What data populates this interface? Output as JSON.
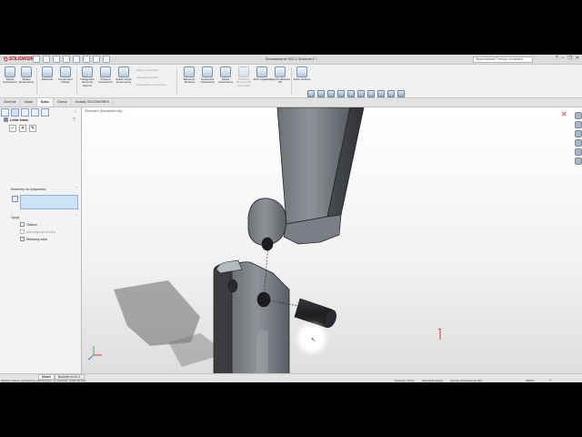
{
  "app": {
    "title": "Rozstawienie 002.2 Złożenie1 *",
    "logo_text": "SOLIDWORKS",
    "search_placeholder": "Wyszukiwanie Pomocy i modelach"
  },
  "ribbon": {
    "buttons": [
      {
        "label": "Edytuj komponent",
        "icon": "edit-component-icon",
        "enabled": true
      },
      {
        "label": "Wstaw komponenty",
        "icon": "insert-components-icon",
        "enabled": true
      },
      {
        "label": "Wiązanie",
        "icon": "mate-icon",
        "enabled": true
      },
      {
        "label": "Komponent liniowy",
        "icon": "linear-pattern-icon",
        "enabled": true
      },
      {
        "label": "Inteligentne elementy złączne",
        "icon": "smart-fasteners-icon",
        "enabled": true
      },
      {
        "label": "Przesuń komponent",
        "icon": "move-component-icon",
        "enabled": true
      },
      {
        "label": "Pokaż ukryte komponenty",
        "icon": "show-hidden-icon",
        "enabled": true
      },
      {
        "label": "Elementy złożenia",
        "icon": "assembly-features-icon",
        "enabled": true
      },
      {
        "label": "Geometria odniesienia",
        "icon": "reference-geometry-icon",
        "enabled": true
      },
      {
        "label": "Widok rozstrzelony",
        "icon": "exploded-view-icon",
        "enabled": true
      },
      {
        "label": "Natychmiastowe 3D",
        "icon": "instant-3d-icon",
        "enabled": true
      },
      {
        "label": "Aktualizuj komponenty Speedpak",
        "icon": "speedpak-icon",
        "enabled": false
      },
      {
        "label": "Zrób migawkę",
        "icon": "snapshot-icon",
        "enabled": true
      },
      {
        "label": "Duże złożenie",
        "icon": "large-assembly-icon",
        "enabled": true
      }
    ],
    "disabled_small": [
      "Szkicu elementów",
      "Zaprojektuj obiekt",
      "Wyświetlanie elementów"
    ]
  },
  "tabs": [
    "Złożenie",
    "Układ",
    "Szkic",
    "Ocena",
    "Dodatki SOLIDWORKS"
  ],
  "active_tab": "Szkic",
  "property_manager": {
    "title": "Linia kraw.",
    "help": "?",
    "actions": [
      "✓",
      "✕",
      "✎"
    ],
    "group_elements": "Elementy do połączenia",
    "group_options": "Opcje",
    "options": [
      {
        "label": "Odwróć",
        "checked": false,
        "enabled": true
      },
      {
        "label": "Alternatywna ścieżka",
        "checked": false,
        "enabled": false
      },
      {
        "label": "Widoczny szkic",
        "checked": true,
        "enabled": true
      }
    ]
  },
  "viewport": {
    "tree_flyout": "Złożenie1 (Domyślne<Wy...",
    "ok": "✓",
    "cancel": "✕"
  },
  "status": {
    "bottom_tabs": [
      "Model",
      "Badanie ruchu 1"
    ],
    "active_bottom_tab": "Model",
    "hint": "Wybierz ścianę cylindryczną, płaszczyznę, oś, krawędź, punkt lub linię",
    "right": [
      "Średnica: 20mm",
      "Niedodefiniowany",
      "Edycja: Rozstawienie 002"
    ],
    "units": "MMGS",
    "help": "?"
  },
  "colors": {
    "brand": "#c8102e",
    "selection_box": "#cfe3f8",
    "ok_green": "#3aa43f",
    "cancel_red": "#dd6a6a"
  }
}
